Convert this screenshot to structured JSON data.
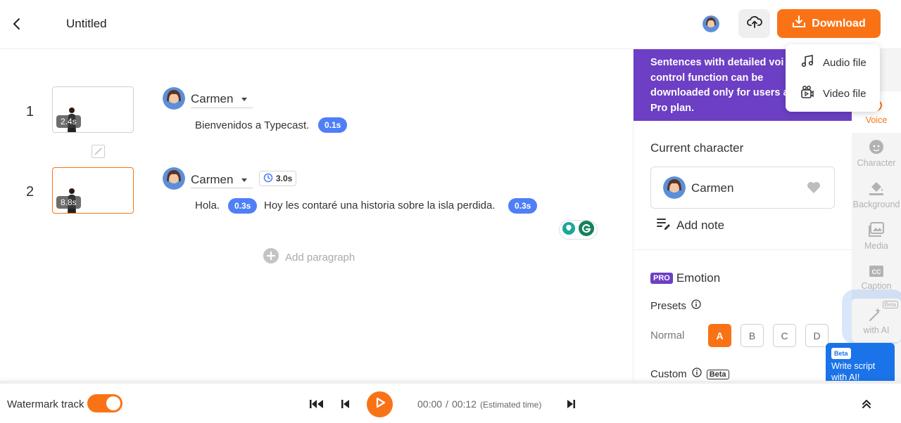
{
  "header": {
    "title": "Untitled",
    "download_label": "Download"
  },
  "download_menu": {
    "items": [
      {
        "label": "Audio file",
        "icon": "music-note-icon"
      },
      {
        "label": "Video file",
        "icon": "video-file-icon"
      }
    ]
  },
  "paragraphs": [
    {
      "number": "1",
      "thumb_duration": "2.4s",
      "voice": "Carmen",
      "timer": "",
      "segments": [
        {
          "text": "Bienvenidos a Typecast."
        },
        {
          "pause": "0.1s"
        }
      ]
    },
    {
      "number": "2",
      "thumb_duration": "8.8s",
      "voice": "Carmen",
      "timer": "3.0s",
      "segments": [
        {
          "text": "Hola."
        },
        {
          "pause": "0.3s"
        },
        {
          "text": "Hoy les contaré una historia sobre la isla perdida."
        },
        {
          "pause": "0.3s"
        }
      ]
    }
  ],
  "add_paragraph_label": "Add paragraph",
  "right_panel": {
    "promo_lines": [
      "Sentences with detailed voi",
      "control function can be",
      "downloaded only for users a",
      "Pro plan."
    ],
    "current_character_title": "Current character",
    "character_name": "Carmen",
    "add_note_label": "Add note",
    "pro_badge": "PRO",
    "emotion_title": "Emotion",
    "presets_label": "Presets",
    "normal_label": "Normal",
    "preset_options": [
      "A",
      "B",
      "C",
      "D"
    ],
    "preset_selected": "A",
    "custom_label": "Custom",
    "beta_badge": "Beta"
  },
  "tab_rail": {
    "tabs": [
      {
        "label": "Voice",
        "icon": "voice-icon",
        "active": true
      },
      {
        "label": "Character",
        "icon": "character-face-icon",
        "active": false
      },
      {
        "label": "Background",
        "icon": "paint-bucket-icon",
        "active": false
      },
      {
        "label": "Media",
        "icon": "image-icon",
        "active": false
      },
      {
        "label": "Caption",
        "icon": "caption-cc-icon",
        "active": false
      },
      {
        "label": "with AI",
        "icon": "magic-wand-icon",
        "active": false,
        "badge": "Beta"
      }
    ]
  },
  "ai_tooltip": {
    "badge": "Beta",
    "text": "Write script with AI!"
  },
  "bottom_bar": {
    "watermark_label": "Watermark track",
    "watermark_on": true,
    "time_current": "00:00",
    "time_separator": "/",
    "time_total": "00:12",
    "estimated_label": "(Estimated time)"
  },
  "colors": {
    "accent": "#f97316",
    "pause_badge": "#4f7ff7",
    "promo": "#6c3fc4"
  }
}
